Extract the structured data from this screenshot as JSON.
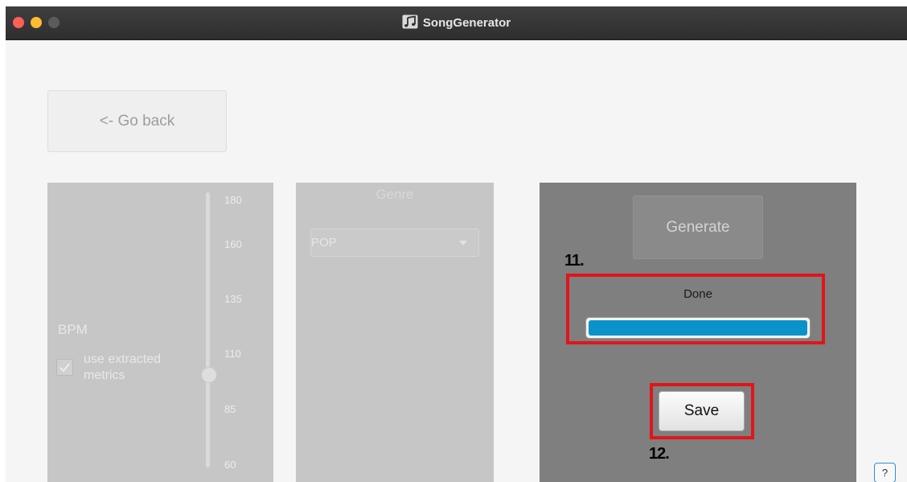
{
  "window": {
    "title": "SongGenerator",
    "icon": "music-note-icon"
  },
  "back_button": {
    "label": "<- Go back"
  },
  "bpm": {
    "label": "BPM",
    "checkbox_label": "use extracted metrics",
    "checked": true,
    "ticks": [
      "180",
      "160",
      "135",
      "110",
      "85",
      "60"
    ]
  },
  "genre": {
    "title": "Genre",
    "selected": "POP"
  },
  "generator": {
    "generate_label": "Generate",
    "step_11": "11.",
    "status": "Done",
    "progress": 1.0,
    "save_label": "Save",
    "step_12": "12."
  },
  "help": {
    "label": "?"
  },
  "colors": {
    "progress": "#0a93c9",
    "highlight": "#e2141b"
  }
}
